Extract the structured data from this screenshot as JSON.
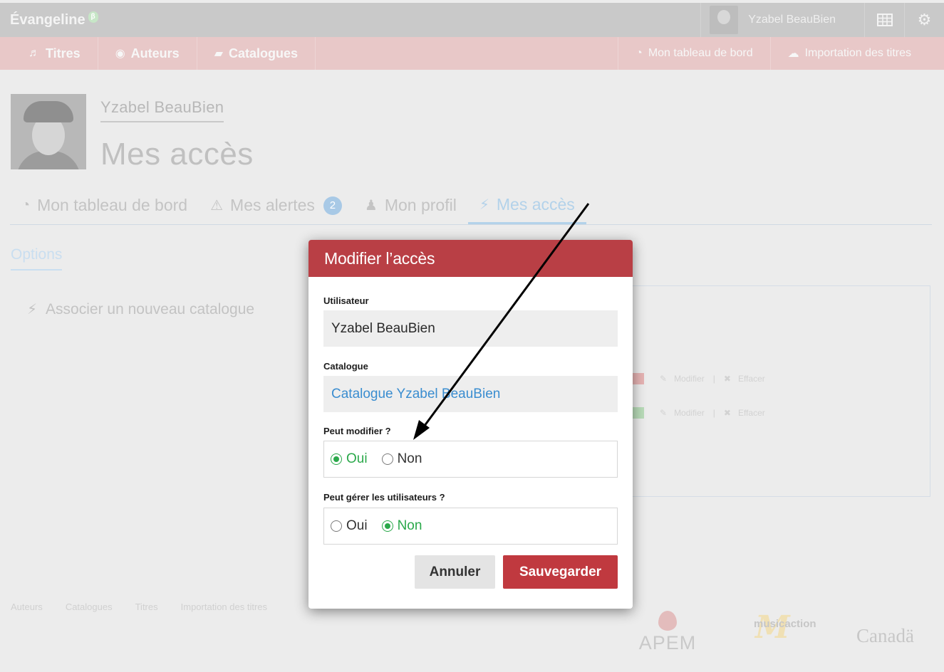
{
  "header": {
    "brand": "Évangeline",
    "brand_badge": "β",
    "user_name": "Yzabel BeauBien",
    "icons": [
      "grid-icon",
      "gear-icon"
    ]
  },
  "nav": {
    "left": [
      {
        "icon": "music-note-icon",
        "label": "Titres"
      },
      {
        "icon": "user-circle-icon",
        "label": "Auteurs"
      },
      {
        "icon": "book-icon",
        "label": "Catalogues"
      }
    ],
    "right": [
      {
        "icon": "dashboard-icon",
        "label": "Mon tableau de bord"
      },
      {
        "icon": "cloud-upload-icon",
        "label": "Importation des titres"
      }
    ]
  },
  "profile": {
    "name": "Yzabel BeauBien",
    "page_title": "Mes accès"
  },
  "tabs": [
    {
      "icon": "dashboard-icon",
      "label": "Mon tableau de bord"
    },
    {
      "icon": "warning-icon",
      "label": "Mes alertes",
      "count": "2"
    },
    {
      "icon": "user-icon",
      "label": "Mon profil"
    },
    {
      "icon": "plug-icon",
      "label": "Mes accès",
      "active": true
    }
  ],
  "options": {
    "tab_label": "Options",
    "associate_label": "Associer un nouveau catalogue"
  },
  "background_table": {
    "rows": [
      {
        "edit": "Modifier",
        "delete": "Effacer",
        "status_color": "#e6b3b3"
      },
      {
        "edit": "Modifier",
        "delete": "Effacer",
        "status_color": "#b9dcb9"
      }
    ]
  },
  "modal": {
    "title": "Modifier l’accès",
    "user_label": "Utilisateur",
    "user_value": "Yzabel BeauBien",
    "catalogue_label": "Catalogue",
    "catalogue_value": "Catalogue Yzabel BeauBien",
    "can_edit_label": "Peut modifier ?",
    "can_edit_options": [
      "Oui",
      "Non"
    ],
    "can_edit_selected": "Oui",
    "can_manage_label": "Peut gérer les utilisateurs ?",
    "can_manage_options": [
      "Oui",
      "Non"
    ],
    "can_manage_selected": "Non",
    "cancel_label": "Annuler",
    "save_label": "Sauvegarder"
  },
  "footer": {
    "links": [
      "Auteurs",
      "Catalogues",
      "Titres",
      "Importation des titres"
    ],
    "logos": {
      "apem": "APEM",
      "musicaction": "musicaction",
      "canada": "Canadä"
    }
  },
  "colors": {
    "modal_header": "#b93f45",
    "save_button": "#c0393f",
    "selected_radio": "#2aa84a",
    "link": "#3a8dd0"
  }
}
